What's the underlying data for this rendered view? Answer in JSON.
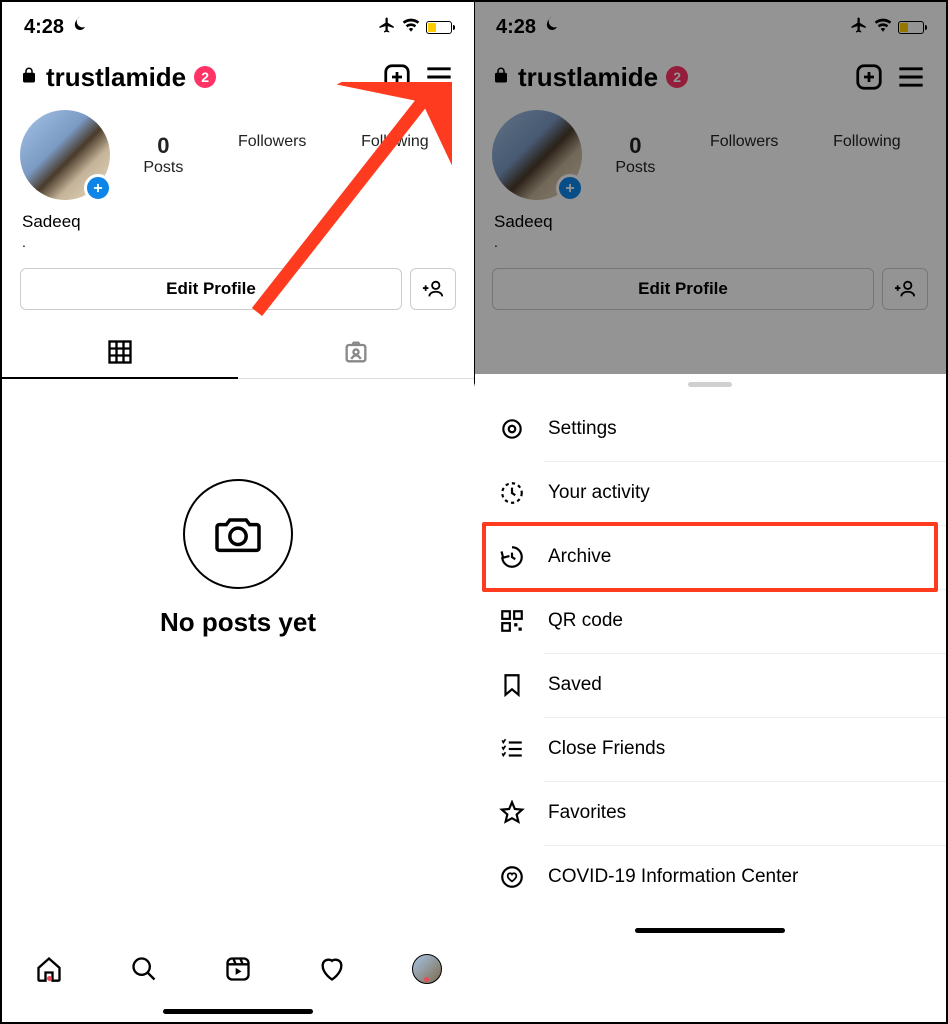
{
  "status": {
    "time": "4:28"
  },
  "profile": {
    "username": "trustlamide",
    "badge_count": "2",
    "display_name": "Sadeeq",
    "stats": {
      "posts_value": "0",
      "posts_label": "Posts",
      "followers_value": "",
      "followers_label": "Followers",
      "following_value": "",
      "following_label": "Following"
    },
    "edit_button": "Edit Profile",
    "empty_message": "No posts yet"
  },
  "menu": {
    "items": [
      {
        "label": "Settings"
      },
      {
        "label": "Your activity"
      },
      {
        "label": "Archive"
      },
      {
        "label": "QR code"
      },
      {
        "label": "Saved"
      },
      {
        "label": "Close Friends"
      },
      {
        "label": "Favorites"
      },
      {
        "label": "COVID-19 Information Center"
      }
    ],
    "highlighted_index": 2
  },
  "annotation": {
    "arrow_target": "hamburger-menu-button",
    "highlight_color": "#fe3b1f"
  }
}
